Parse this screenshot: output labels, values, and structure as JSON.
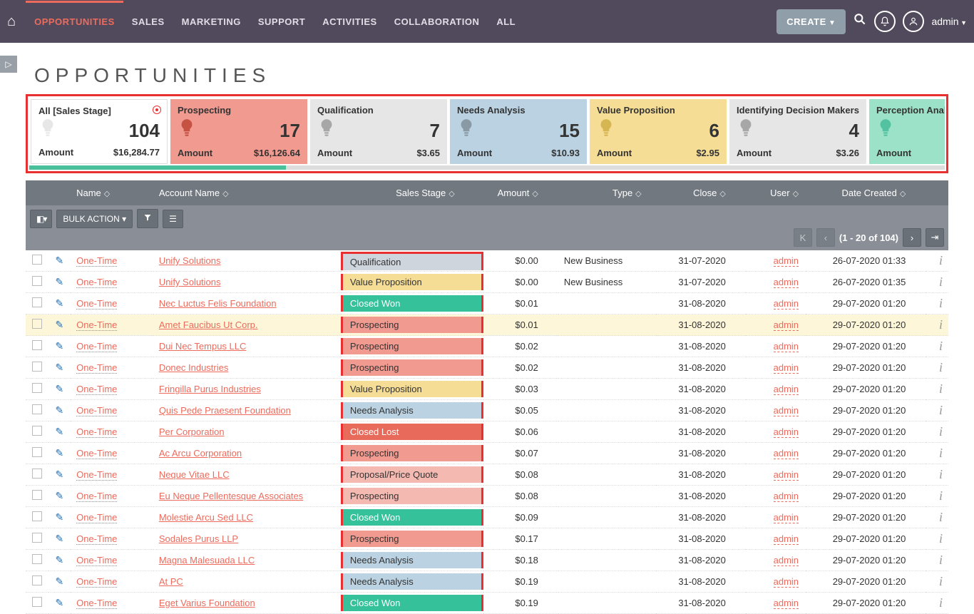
{
  "nav": {
    "items": [
      "OPPORTUNITIES",
      "SALES",
      "MARKETING",
      "SUPPORT",
      "ACTIVITIES",
      "COLLABORATION",
      "ALL"
    ],
    "create": "CREATE",
    "user": "admin"
  },
  "page": {
    "title": "OPPORTUNITIES"
  },
  "kanban": [
    {
      "title": "All [Sales Stage]",
      "count": "104",
      "amtlbl": "Amount",
      "amt": "$16,284.77",
      "cls": "white",
      "dot": true
    },
    {
      "title": "Prospecting",
      "count": "17",
      "amtlbl": "Amount",
      "amt": "$16,126.64",
      "cls": "red"
    },
    {
      "title": "Qualification",
      "count": "7",
      "amtlbl": "Amount",
      "amt": "$3.65",
      "cls": "grey"
    },
    {
      "title": "Needs Analysis",
      "count": "15",
      "amtlbl": "Amount",
      "amt": "$10.93",
      "cls": "blue"
    },
    {
      "title": "Value Proposition",
      "count": "6",
      "amtlbl": "Amount",
      "amt": "$2.95",
      "cls": "yellow"
    },
    {
      "title": "Identifying Decision Makers",
      "count": "4",
      "amtlbl": "Amount",
      "amt": "$3.26",
      "cls": "grey"
    },
    {
      "title": "Perception Analy",
      "count": "",
      "amtlbl": "Amount",
      "amt": "",
      "cls": "teal"
    }
  ],
  "table": {
    "headers": [
      "Name",
      "Account Name",
      "Sales Stage",
      "Amount",
      "Type",
      "Close",
      "User",
      "Date Created"
    ],
    "toolbar": {
      "bulk": "BULK ACTION",
      "pageinfo": "(1 - 20 of 104)"
    },
    "rows": [
      {
        "name": "One-Time",
        "acct": "Unify Solutions",
        "stage": "Qualification",
        "amt": "$0.00",
        "type": "New Business",
        "close": "31-07-2020",
        "user": "admin",
        "created": "26-07-2020 01:33"
      },
      {
        "name": "One-Time",
        "acct": "Unify Solutions",
        "stage": "Value Proposition",
        "amt": "$0.00",
        "type": "New Business",
        "close": "31-07-2020",
        "user": "admin",
        "created": "26-07-2020 01:35"
      },
      {
        "name": "One-Time",
        "acct": "Nec Luctus Felis Foundation",
        "stage": "Closed Won",
        "amt": "$0.01",
        "type": "",
        "close": "31-08-2020",
        "user": "admin",
        "created": "29-07-2020 01:20"
      },
      {
        "name": "One-Time",
        "acct": "Amet Faucibus Ut Corp.",
        "stage": "Prospecting",
        "amt": "$0.01",
        "type": "",
        "close": "31-08-2020",
        "user": "admin",
        "created": "29-07-2020 01:20",
        "hl": true
      },
      {
        "name": "One-Time",
        "acct": "Dui Nec Tempus LLC",
        "stage": "Prospecting",
        "amt": "$0.02",
        "type": "",
        "close": "31-08-2020",
        "user": "admin",
        "created": "29-07-2020 01:20"
      },
      {
        "name": "One-Time",
        "acct": "Donec Industries",
        "stage": "Prospecting",
        "amt": "$0.02",
        "type": "",
        "close": "31-08-2020",
        "user": "admin",
        "created": "29-07-2020 01:20"
      },
      {
        "name": "One-Time",
        "acct": "Fringilla Purus Industries",
        "stage": "Value Proposition",
        "amt": "$0.03",
        "type": "",
        "close": "31-08-2020",
        "user": "admin",
        "created": "29-07-2020 01:20"
      },
      {
        "name": "One-Time",
        "acct": "Quis Pede Praesent Foundation",
        "stage": "Needs Analysis",
        "amt": "$0.05",
        "type": "",
        "close": "31-08-2020",
        "user": "admin",
        "created": "29-07-2020 01:20"
      },
      {
        "name": "One-Time",
        "acct": "Per Corporation",
        "stage": "Closed Lost",
        "amt": "$0.06",
        "type": "",
        "close": "31-08-2020",
        "user": "admin",
        "created": "29-07-2020 01:20"
      },
      {
        "name": "One-Time",
        "acct": "Ac Arcu Corporation",
        "stage": "Prospecting",
        "amt": "$0.07",
        "type": "",
        "close": "31-08-2020",
        "user": "admin",
        "created": "29-07-2020 01:20"
      },
      {
        "name": "One-Time",
        "acct": "Neque Vitae LLC",
        "stage": "Proposal/Price Quote",
        "amt": "$0.08",
        "type": "",
        "close": "31-08-2020",
        "user": "admin",
        "created": "29-07-2020 01:20"
      },
      {
        "name": "One-Time",
        "acct": "Eu Neque Pellentesque Associates",
        "stage": "Prospecting",
        "amt": "$0.08",
        "type": "",
        "close": "31-08-2020",
        "user": "admin",
        "created": "29-07-2020 01:20",
        "scls": "Prospecting2"
      },
      {
        "name": "One-Time",
        "acct": "Molestie Arcu Sed LLC",
        "stage": "Closed Won",
        "amt": "$0.09",
        "type": "",
        "close": "31-08-2020",
        "user": "admin",
        "created": "29-07-2020 01:20"
      },
      {
        "name": "One-Time",
        "acct": "Sodales Purus LLP",
        "stage": "Prospecting",
        "amt": "$0.17",
        "type": "",
        "close": "31-08-2020",
        "user": "admin",
        "created": "29-07-2020 01:20"
      },
      {
        "name": "One-Time",
        "acct": "Magna Malesuada LLC",
        "stage": "Needs Analysis",
        "amt": "$0.18",
        "type": "",
        "close": "31-08-2020",
        "user": "admin",
        "created": "29-07-2020 01:20"
      },
      {
        "name": "One-Time",
        "acct": "At PC",
        "stage": "Needs Analysis",
        "amt": "$0.19",
        "type": "",
        "close": "31-08-2020",
        "user": "admin",
        "created": "29-07-2020 01:20"
      },
      {
        "name": "One-Time",
        "acct": "Eget Varius Foundation",
        "stage": "Closed Won",
        "amt": "$0.19",
        "type": "",
        "close": "31-08-2020",
        "user": "admin",
        "created": "29-07-2020 01:20"
      }
    ]
  }
}
